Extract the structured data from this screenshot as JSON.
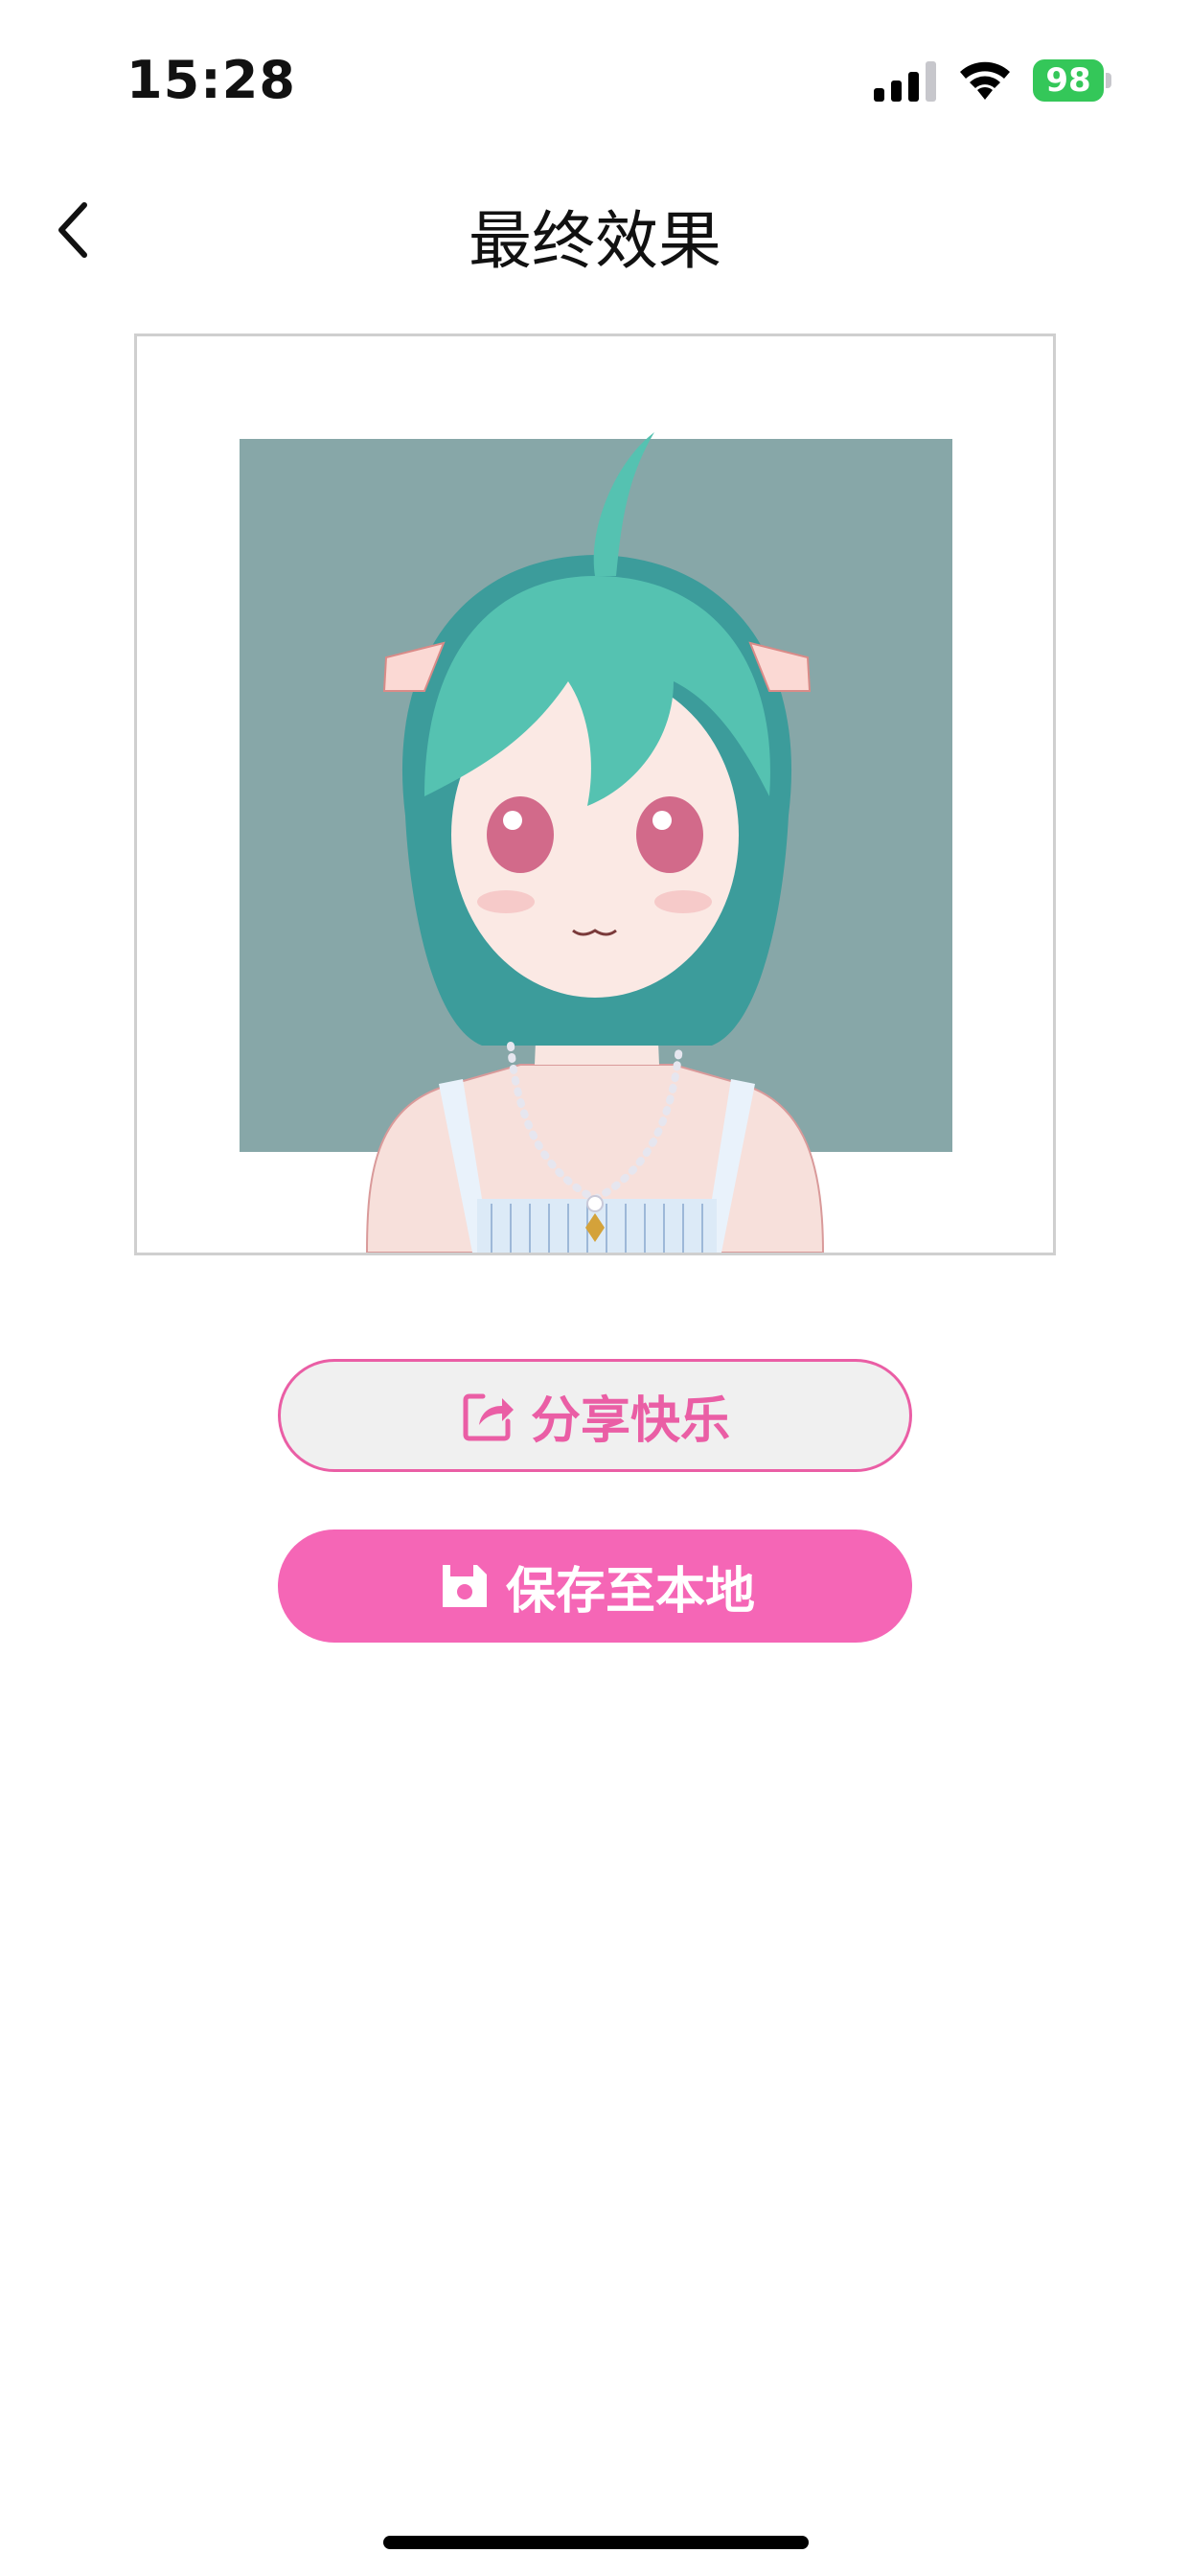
{
  "status_bar": {
    "time": "15:28",
    "battery": "98"
  },
  "header": {
    "title": "最终效果"
  },
  "actions": {
    "share_label": "分享快乐",
    "save_label": "保存至本地"
  },
  "icons": {
    "back": "chevron-left-icon",
    "share": "share-icon",
    "save": "save-icon"
  },
  "colors": {
    "accent": "#f566b6",
    "accent_border": "#ea5ea5",
    "avatar_bg": "#87a7a8",
    "battery": "#34c759"
  }
}
